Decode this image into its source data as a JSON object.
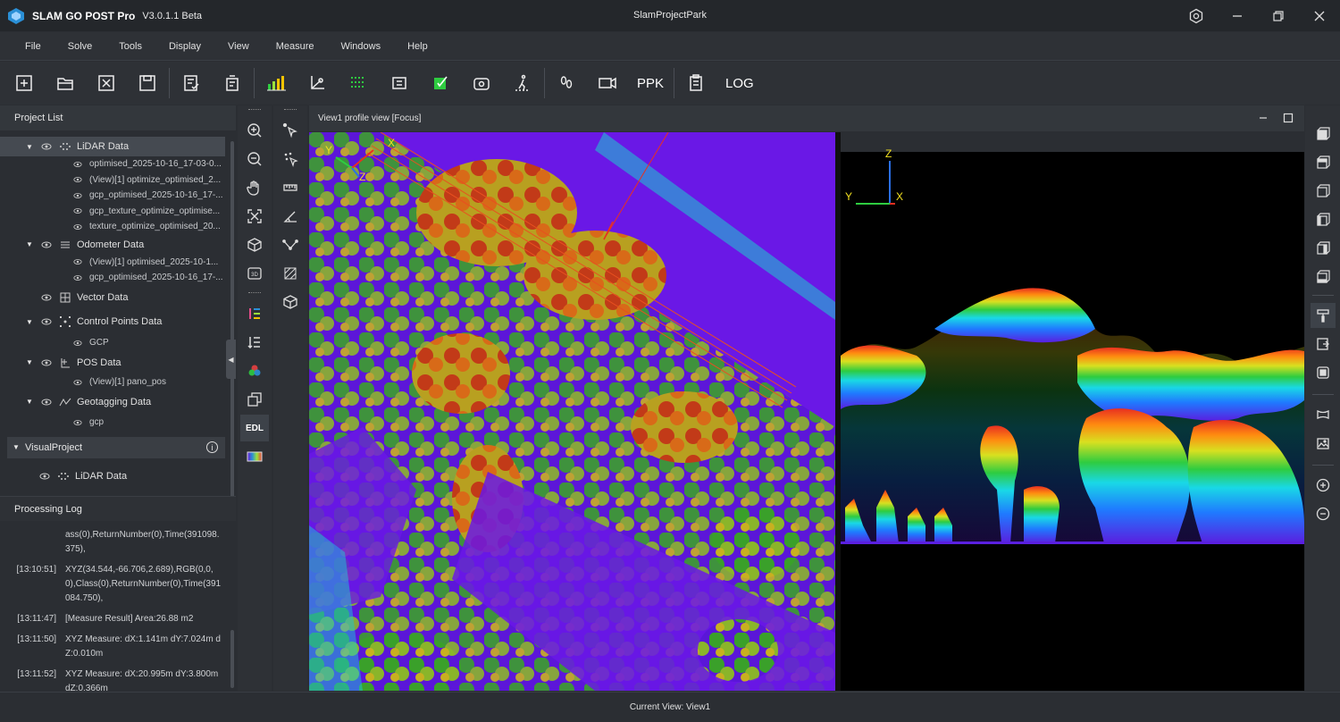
{
  "app": {
    "name": "SLAM GO POST Pro",
    "version": "V3.0.1.1 Beta",
    "window_title": "SlamProjectPark"
  },
  "menu": [
    "File",
    "Solve",
    "Tools",
    "Display",
    "View",
    "Measure",
    "Windows",
    "Help"
  ],
  "toolbar": {
    "ppk_label": "PPK",
    "log_label": "LOG"
  },
  "project_list": {
    "title": "Project List",
    "lidar": {
      "label": "LiDAR Data",
      "items": [
        "optimised_2025-10-16_17-03-0...",
        "(View)[1] optimize_optimised_2...",
        "gcp_optimised_2025-10-16_17-...",
        "gcp_texture_optimize_optimise...",
        "texture_optimize_optimised_20..."
      ]
    },
    "odometer": {
      "label": "Odometer Data",
      "items": [
        "(View)[1] optimised_2025-10-1...",
        "gcp_optimised_2025-10-16_17-..."
      ]
    },
    "vector": {
      "label": "Vector Data"
    },
    "control": {
      "label": "Control Points Data",
      "items": [
        "GCP"
      ]
    },
    "pos": {
      "label": "POS Data",
      "items": [
        "(View)[1] pano_pos"
      ]
    },
    "geotag": {
      "label": "Geotagging Data",
      "items": [
        "gcp"
      ]
    },
    "visual_project": {
      "label": "VisualProject",
      "info_icon": "i",
      "lidar_label": "LiDAR Data"
    }
  },
  "processing_log": {
    "title": "Processing Log",
    "entries": [
      {
        "time": "",
        "msg": "ass(0),ReturnNumber(0),Time(391098.375),"
      },
      {
        "time": "[13:10:51]",
        "msg": "XYZ(34.544,-66.706,2.689),RGB(0,0,0),Class(0),ReturnNumber(0),Time(391084.750),"
      },
      {
        "time": "[13:11:47]",
        "msg": "[Measure Result] Area:26.88 m2"
      },
      {
        "time": "[13:11:50]",
        "msg": "XYZ Measure: dX:1.141m dY:7.024m dZ:0.010m"
      },
      {
        "time": "[13:11:52]",
        "msg": "XYZ Measure: dX:20.995m dY:3.800m dZ:0.366m"
      }
    ]
  },
  "view": {
    "header": "View1 profile view [Focus]",
    "edl_label": "EDL"
  },
  "axes": {
    "top_y": "Y",
    "top_x": "X",
    "top_z": "Z",
    "side_z": "Z",
    "side_y": "Y",
    "side_x": "X"
  },
  "status": {
    "current_view": "Current View: View1"
  }
}
